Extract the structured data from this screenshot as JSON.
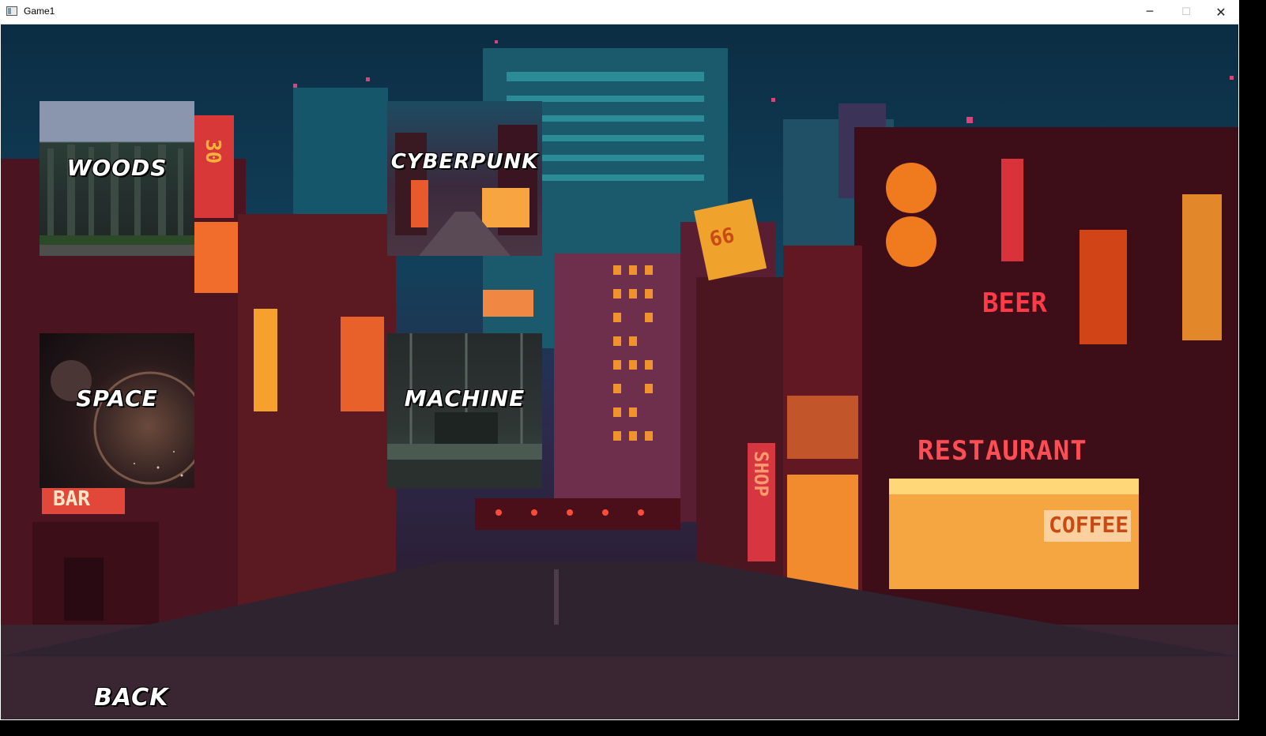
{
  "window": {
    "title": "Game1",
    "minimize": "─",
    "maximize": "☐",
    "close": "✕"
  },
  "levels": [
    {
      "label": "WOODS"
    },
    {
      "label": "CYBERPUNK"
    },
    {
      "label": "SPACE"
    },
    {
      "label": "MACHINE"
    }
  ],
  "back_label": "BACK",
  "background_signs": {
    "beer": "BEER",
    "restaurant": "RESTAURANT",
    "coffee": "COFFEE",
    "shop": "SHOP",
    "num30": "30",
    "num66": "66",
    "bar": "BAR"
  }
}
